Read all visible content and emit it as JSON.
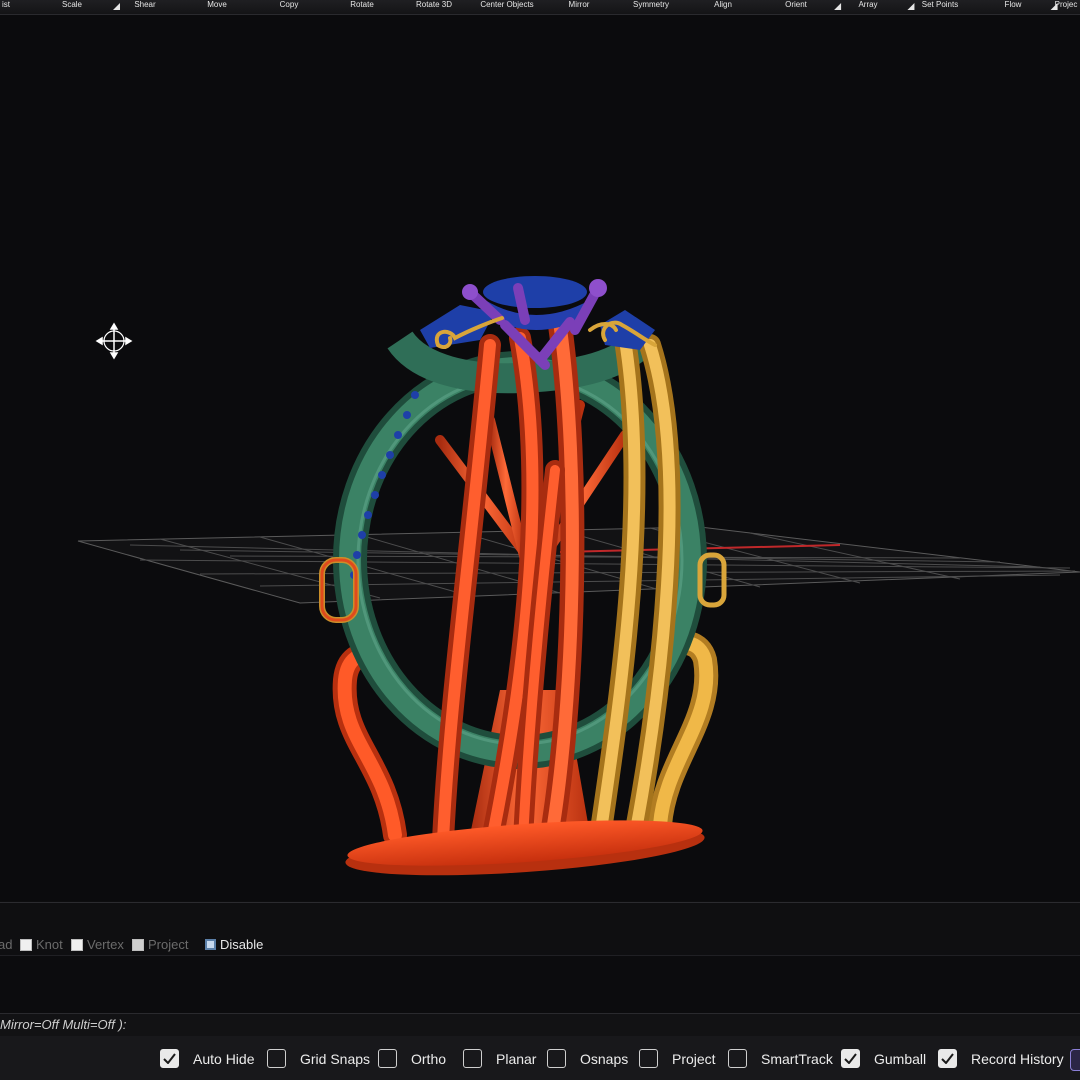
{
  "toolbar": {
    "items": [
      {
        "label": "ist",
        "has_menu": false
      },
      {
        "label": "Scale",
        "has_menu": true
      },
      {
        "label": "Shear",
        "has_menu": false
      },
      {
        "label": "Move",
        "has_menu": false
      },
      {
        "label": "Copy",
        "has_menu": false
      },
      {
        "label": "Rotate",
        "has_menu": false
      },
      {
        "label": "Rotate 3D",
        "has_menu": false
      },
      {
        "label": "Center Objects",
        "has_menu": false
      },
      {
        "label": "Mirror",
        "has_menu": false
      },
      {
        "label": "Symmetry",
        "has_menu": false
      },
      {
        "label": "Align",
        "has_menu": false
      },
      {
        "label": "Orient",
        "has_menu": true
      },
      {
        "label": "Array",
        "has_menu": true
      },
      {
        "label": "Set Points",
        "has_menu": false
      },
      {
        "label": "Flow",
        "has_menu": true
      },
      {
        "label": "Projec",
        "has_menu": false
      }
    ]
  },
  "viewport": {
    "colors": {
      "background": "#0b0b0d",
      "shank": "#2f6e57",
      "sprue_red": "#e04a1c",
      "sprue_yellow": "#e0a83a",
      "gem_blue": "#1e3fa8",
      "prong_purple": "#7b3fb8",
      "gold_detail": "#d9a53a",
      "grid": "#6b6b6b",
      "axis_x": "#c0282a",
      "axis_y": "#2d8a3a"
    },
    "gumball_icon": "move-cursor-icon"
  },
  "osnap": {
    "items": [
      {
        "label": "ad",
        "checked": null,
        "enabled": false
      },
      {
        "label": "Knot",
        "checked": false,
        "enabled": false
      },
      {
        "label": "Vertex",
        "checked": false,
        "enabled": false
      },
      {
        "label": "Project",
        "checked": false,
        "enabled": false
      },
      {
        "label": "Disable",
        "checked": true,
        "enabled": true
      }
    ]
  },
  "command": {
    "text": "Mirror=Off  Multi=Off ):"
  },
  "statusbar": {
    "items": [
      {
        "label": "Auto Hide",
        "checked": true
      },
      {
        "label": "Grid Snaps",
        "checked": false
      },
      {
        "label": "Ortho",
        "checked": false
      },
      {
        "label": "Planar",
        "checked": false
      },
      {
        "label": "Osnaps",
        "checked": false
      },
      {
        "label": "Project",
        "checked": false
      },
      {
        "label": "SmartTrack",
        "checked": false
      },
      {
        "label": "Gumball",
        "checked": true
      },
      {
        "label": "Record History",
        "checked": true
      }
    ]
  }
}
